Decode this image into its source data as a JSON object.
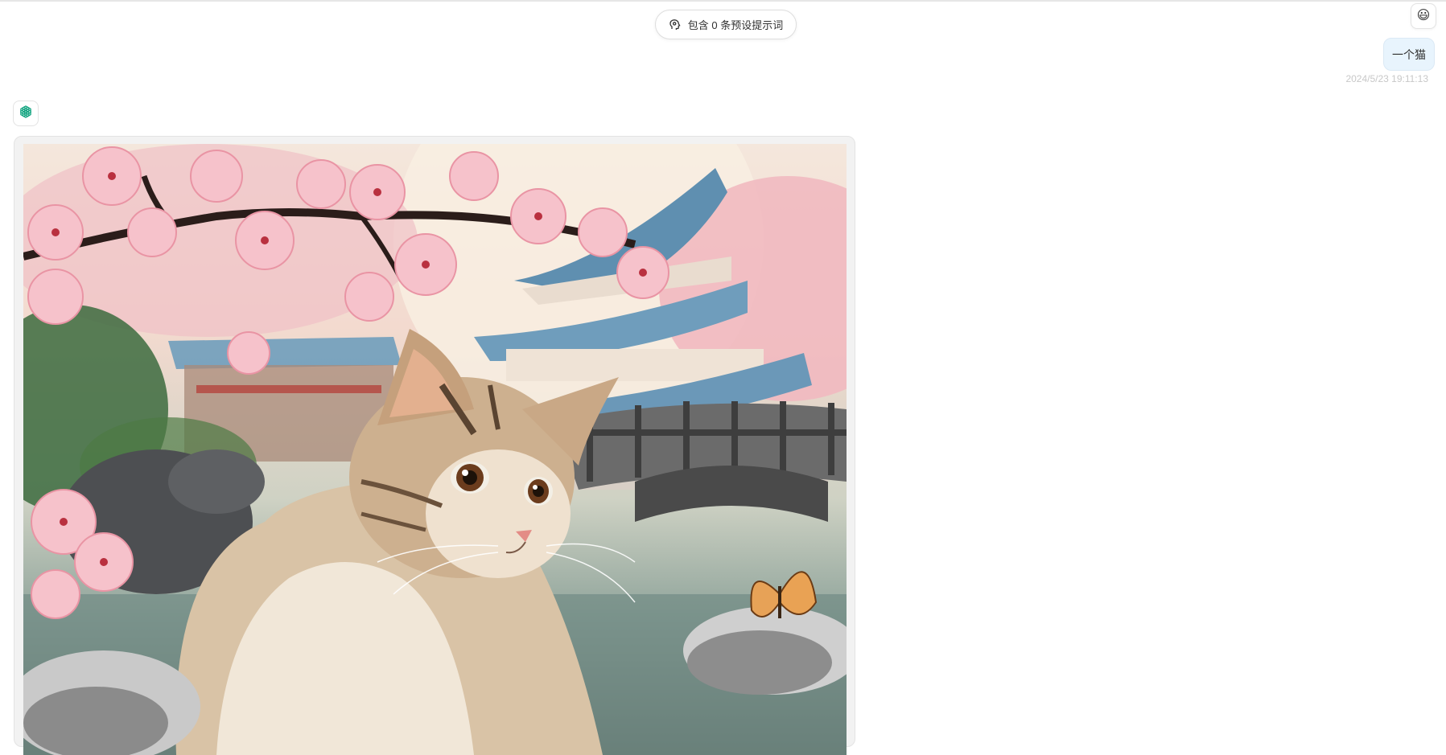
{
  "header": {
    "prompt_pill_label": "包含 0 条预设提示词",
    "prompt_icon": "brain-icon"
  },
  "user": {
    "avatar_emoji": "😃",
    "message": "一个猫",
    "timestamp": "2024/5/23 19:11:13"
  },
  "assistant": {
    "avatar_icon": "openai-logo-icon",
    "image_subject": "cat"
  },
  "colors": {
    "user_bubble": "#e8f4fd",
    "bot_bubble": "#f2f2f2",
    "timestamp": "#c8c8c8",
    "openai_green": "#10a37f"
  }
}
